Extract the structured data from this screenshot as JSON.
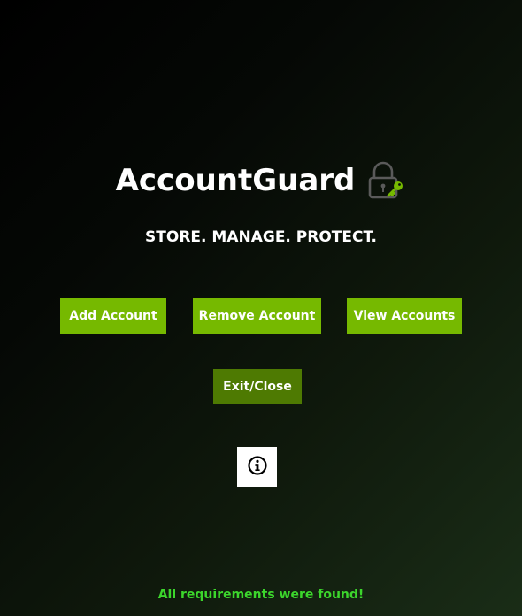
{
  "app": {
    "title": "AccountGuard",
    "tagline": "STORE. MANAGE. PROTECT.",
    "logo_icon": "lock-key-icon"
  },
  "actions": {
    "add_label": "Add Account",
    "remove_label": "Remove Account",
    "view_label": "View Accounts",
    "exit_label": "Exit/Close"
  },
  "info": {
    "icon": "info-icon"
  },
  "status": {
    "message": "All requirements were found!",
    "color": "#3cd62c"
  },
  "theme": {
    "accent": "#76b900",
    "accent_dark": "#4e7a02",
    "background": "#000000"
  }
}
